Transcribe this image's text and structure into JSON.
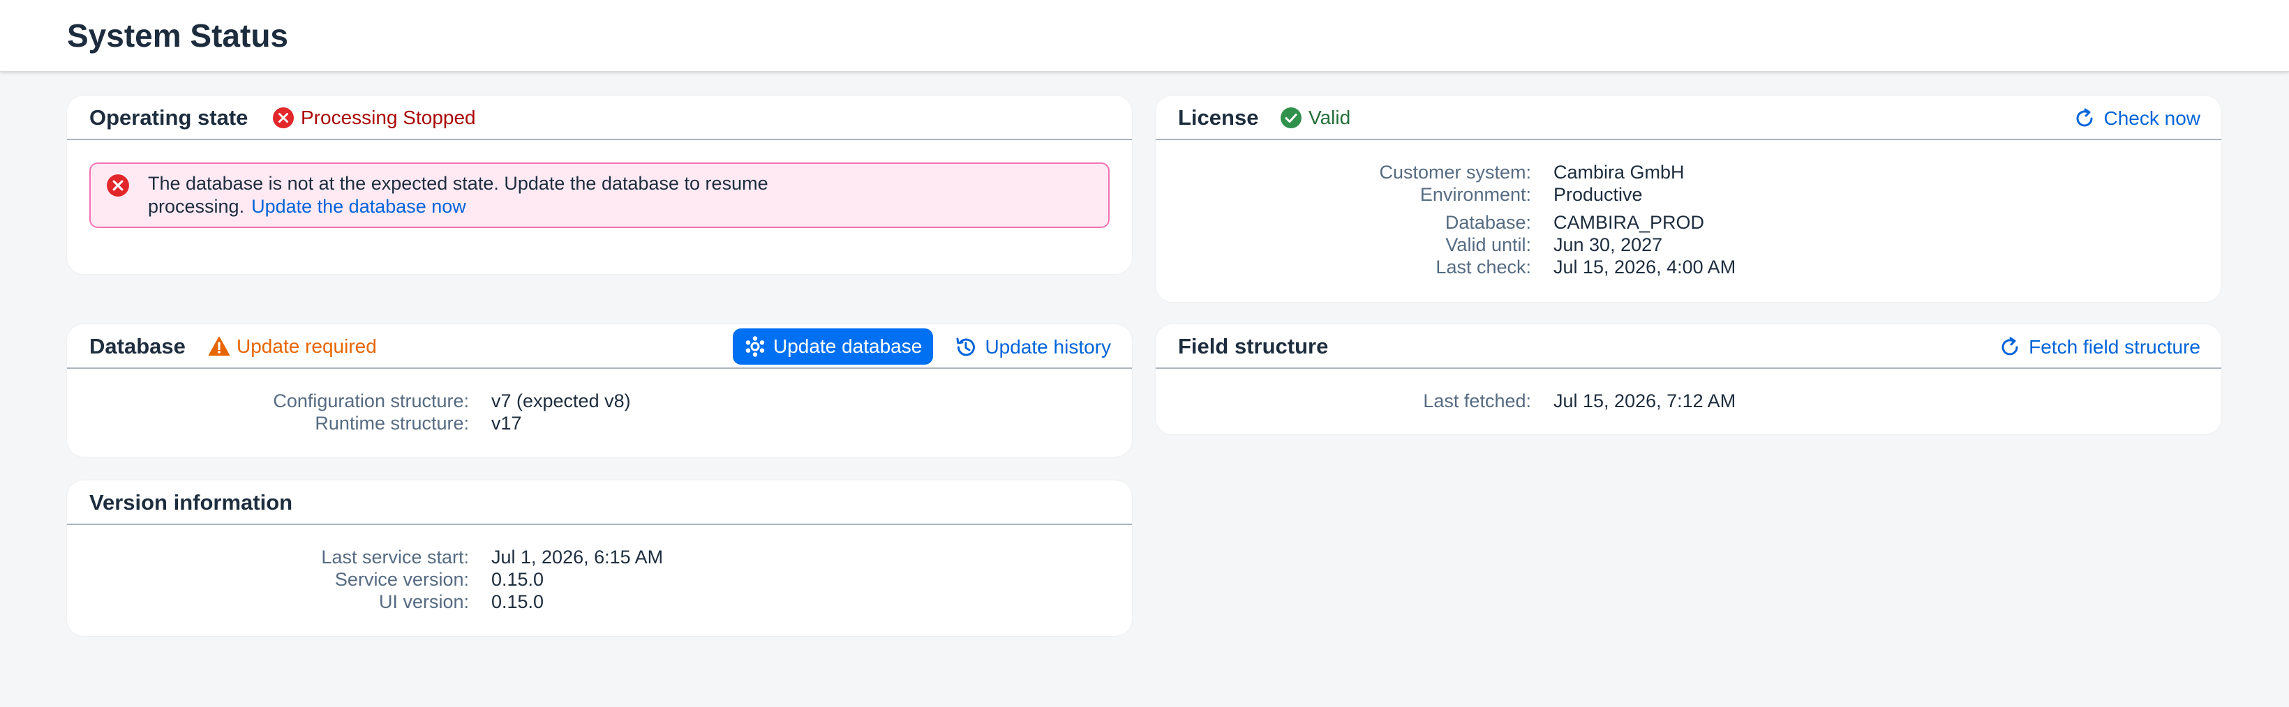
{
  "page": {
    "title": "System Status"
  },
  "colors": {
    "error": "#aa0808",
    "success": "#256f3a",
    "warning": "#e76500",
    "link": "#0064d9",
    "primary": "#0070f2"
  },
  "operating_state": {
    "title": "Operating state",
    "status_icon": "error-circle-icon",
    "status": "Processing Stopped",
    "alert": {
      "icon": "error-circle-icon",
      "message": "The database is not at the expected state. Update the database to resume processing.",
      "link": "Update the database now"
    }
  },
  "license": {
    "title": "License",
    "status_icon": "success-check-icon",
    "status": "Valid",
    "action": {
      "icon": "refresh-icon",
      "label": "Check now"
    },
    "rows": [
      {
        "label": "Customer system:",
        "value": "Cambira GmbH"
      },
      {
        "label": "Environment:",
        "value": "Productive"
      },
      {
        "label": "Database:",
        "value": "CAMBIRA_PROD"
      },
      {
        "label": "Valid until:",
        "value": "Jun 30, 2027"
      },
      {
        "label": "Last check:",
        "value": "Jul 15, 2026, 4:00 AM"
      }
    ]
  },
  "database": {
    "title": "Database",
    "status_icon": "warning-triangle-icon",
    "status": "Update required",
    "primary_action": {
      "icon": "database-update-icon",
      "label": "Update database"
    },
    "history_action": {
      "icon": "history-icon",
      "label": "Update history"
    },
    "rows": [
      {
        "label": "Configuration structure:",
        "value": "v7 (expected v8)"
      },
      {
        "label": "Runtime structure:",
        "value": "v17"
      }
    ]
  },
  "field_structure": {
    "title": "Field structure",
    "action": {
      "icon": "refresh-icon",
      "label": "Fetch field structure"
    },
    "rows": [
      {
        "label": "Last fetched:",
        "value": "Jul 15, 2026, 7:12 AM"
      }
    ]
  },
  "version_info": {
    "title": "Version information",
    "rows": [
      {
        "label": "Last service start:",
        "value": "Jul 1, 2026, 6:15 AM"
      },
      {
        "label": "Service version:",
        "value": "0.15.0"
      },
      {
        "label": "UI version:",
        "value": "0.15.0"
      }
    ]
  }
}
